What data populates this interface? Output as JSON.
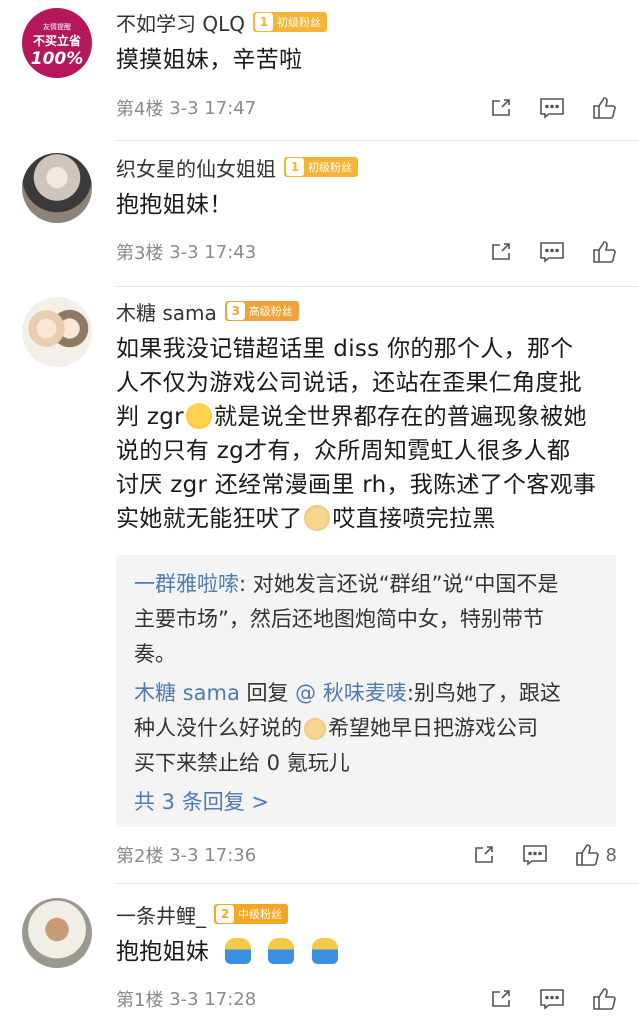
{
  "comments": [
    {
      "username": "不如学习 QLQ",
      "avatar_text_top": "友情提醒",
      "avatar_text_mid": "不买立省",
      "avatar_text_big": "100%",
      "badge_level": "1",
      "badge_label": "初级粉丝",
      "text": "摸摸姐妹，辛苦啦",
      "floor": "第4楼",
      "time": "3-3 17:47"
    },
    {
      "username": "织女星的仙女姐姐",
      "badge_level": "1",
      "badge_label": "初级粉丝",
      "text": "抱抱姐妹！",
      "floor": "第3楼",
      "time": "3-3 17:43"
    },
    {
      "username": "木糖 sama",
      "badge_level": "3",
      "badge_label": "高级粉丝",
      "text_lines": [
        "如果我没记错超话里 diss 你的那个人，那个",
        "人不仅为游戏公司说话，还站在歪果仁角度批",
        "判 zgr",
        "就是说全世界都存在的普遍现象被她",
        "说的只有 zg才有，众所周知霓虹人很多人都",
        "讨厌 zgr 还经常漫画里 rh，我陈述了个客观事",
        "实她就无能狂吠了",
        "哎直接喷完拉黑"
      ],
      "replies": {
        "r1_name": "一群雅啦嗦",
        "r1_line1": ": 对她发言还说“群组”说“中国不是",
        "r1_line2": "主要市场”，然后还地图炮简中女，特别带节",
        "r1_line3": "奏。",
        "r2_name": "木糖 sama",
        "r2_mid": " 回复 ",
        "r2_target": "@ 秋味麦唛",
        "r2_line1": ":别鸟她了，跟这",
        "r2_line2a": "种人没什么好说的",
        "r2_line2b": "希望她早日把游戏公司",
        "r2_line3": "买下来禁止给 0 氪玩儿",
        "more": "共 3 条回复 >"
      },
      "floor": "第2楼",
      "time": "3-3 17:36",
      "likes": "8"
    },
    {
      "username": "一条井鲤_",
      "badge_level": "2",
      "badge_label": "中级粉丝",
      "text": "抱抱姐妹",
      "floor": "第1楼",
      "time": "3-3 17:28"
    }
  ],
  "icons": {
    "share": "share-icon",
    "comment": "comment-icon",
    "like": "thumbs-up-icon"
  },
  "colors": {
    "reply_link": "#4e7bb0",
    "badge": "#f5b433"
  }
}
